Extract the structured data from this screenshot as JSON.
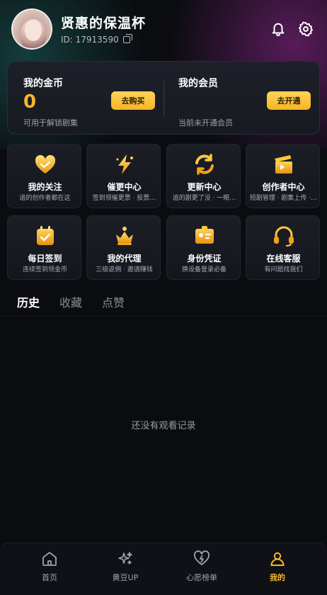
{
  "profile": {
    "username": "贤惠的保温杯",
    "id_label": "ID: 17913590"
  },
  "header_icons": [
    "bell-icon",
    "gear-icon"
  ],
  "wallet": {
    "coins": {
      "title": "我的金币",
      "value": "0",
      "sub": "可用于解锁剧集",
      "button": "去购买"
    },
    "vip": {
      "title": "我的会员",
      "sub": "当前未开通会员",
      "button": "去开通"
    }
  },
  "grid": [
    {
      "title": "我的关注",
      "sub": "追的创作者都在这",
      "icon": "heart-icon"
    },
    {
      "title": "催更中心",
      "sub": "签到领催更票 · 投票…",
      "icon": "lightning-icon"
    },
    {
      "title": "更新中心",
      "sub": "追的剧更了没 · 一眼…",
      "icon": "refresh-icon"
    },
    {
      "title": "创作者中心",
      "sub": "短剧管理 · 剧集上传 ·…",
      "icon": "clapperboard-icon"
    },
    {
      "title": "每日签到",
      "sub": "连续签到领金币",
      "icon": "calendar-check-icon"
    },
    {
      "title": "我的代理",
      "sub": "三级返佣 · 邀请赚钱",
      "icon": "crown-icon"
    },
    {
      "title": "身份凭证",
      "sub": "换设备登录必备",
      "icon": "id-card-icon"
    },
    {
      "title": "在线客服",
      "sub": "有问题找我们",
      "icon": "headset-icon"
    }
  ],
  "tabs": [
    {
      "label": "历史",
      "active": true
    },
    {
      "label": "收藏",
      "active": false
    },
    {
      "label": "点赞",
      "active": false
    }
  ],
  "empty_text": "还没有观看记录",
  "bottom_nav": [
    {
      "label": "首页",
      "icon": "home-icon",
      "active": false
    },
    {
      "label": "黄豆UP",
      "icon": "sparkle-icon",
      "active": false
    },
    {
      "label": "心愿榜单",
      "icon": "heart-broken-icon",
      "active": false
    },
    {
      "label": "我的",
      "icon": "person-icon",
      "active": true
    }
  ],
  "colors": {
    "accent": "#f5b82a",
    "background": "#0b0c10"
  }
}
